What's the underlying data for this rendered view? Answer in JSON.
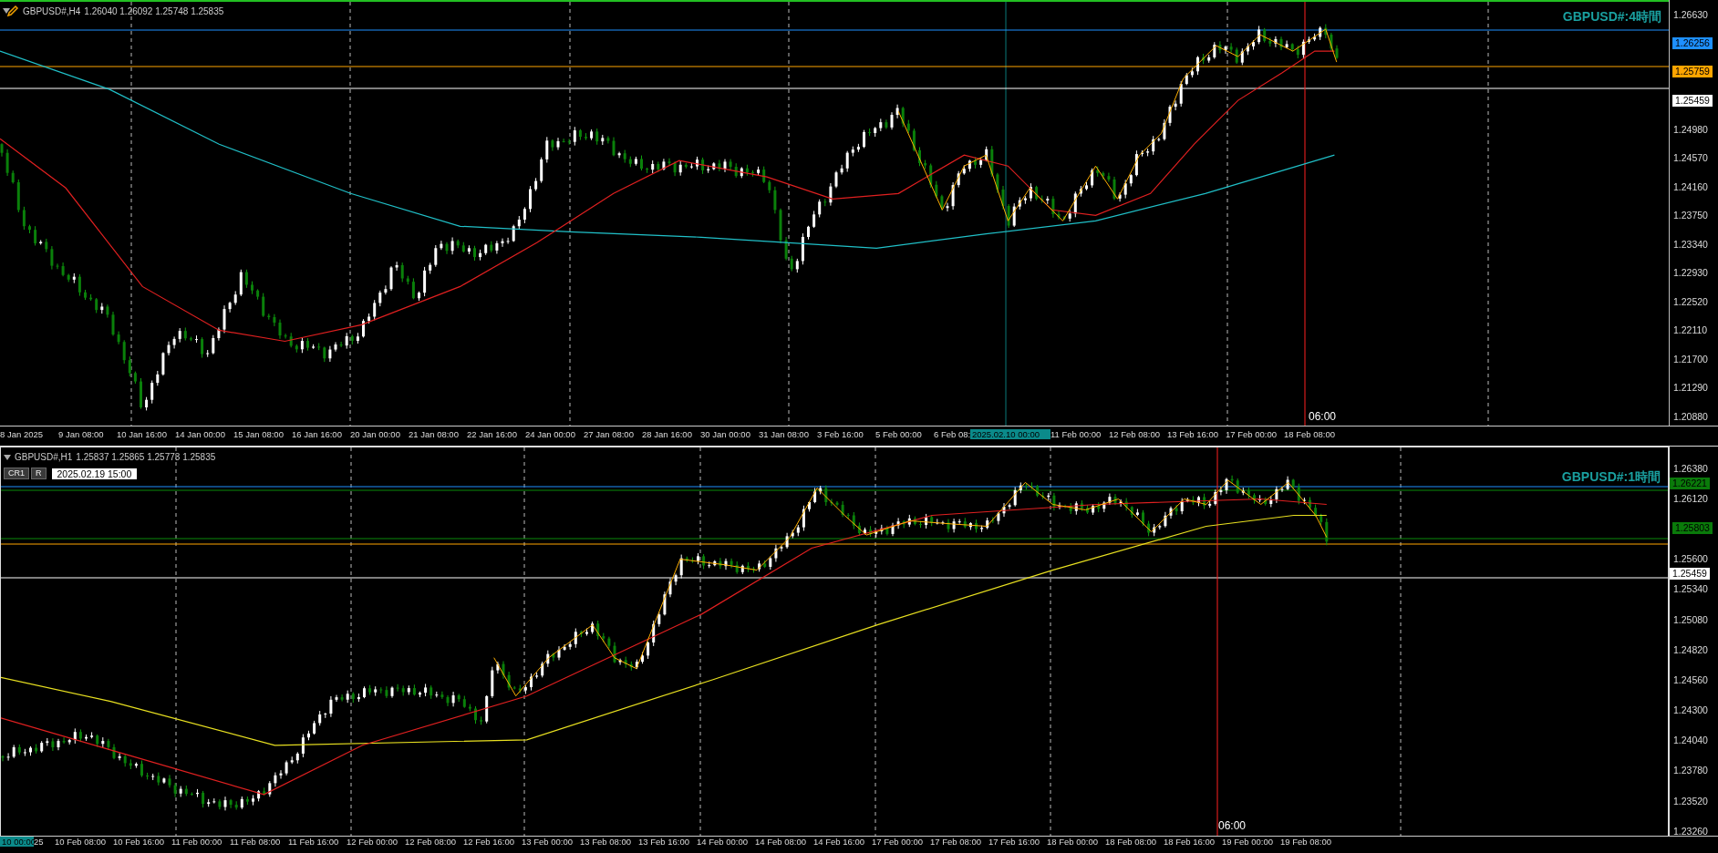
{
  "upper_chart": {
    "symbol": "GBPUSD#,H4",
    "quotes": "1.26040 1.26092 1.25748 1.25835",
    "title": "GBPUSD#:4時間",
    "time_marker": "06:00",
    "price_axis": [
      {
        "kind": "tick",
        "label": "1.26630"
      },
      {
        "kind": "tag",
        "label": "1.26256",
        "color": "#1e90ff"
      },
      {
        "kind": "tag",
        "label": "1.25759",
        "color": "#ffa500"
      },
      {
        "kind": "tag",
        "label": "1.25459",
        "color": "#ffffff"
      },
      {
        "kind": "tick",
        "label": "1.24980"
      },
      {
        "kind": "tick",
        "label": "1.24570"
      },
      {
        "kind": "tick",
        "label": "1.24160"
      },
      {
        "kind": "tick",
        "label": "1.23750"
      },
      {
        "kind": "tick",
        "label": "1.23340"
      },
      {
        "kind": "tick",
        "label": "1.22930"
      },
      {
        "kind": "tick",
        "label": "1.22520"
      },
      {
        "kind": "tick",
        "label": "1.22110"
      },
      {
        "kind": "tick",
        "label": "1.21700"
      },
      {
        "kind": "tick",
        "label": "1.21290"
      },
      {
        "kind": "tick",
        "label": "1.20880"
      }
    ],
    "time_axis": [
      {
        "kind": "tick",
        "label": "8 Jan 2025"
      },
      {
        "kind": "tick",
        "label": "9 Jan 08:00"
      },
      {
        "kind": "tick",
        "label": "10 Jan 16:00"
      },
      {
        "kind": "tick",
        "label": "14 Jan 00:00"
      },
      {
        "kind": "tick",
        "label": "15 Jan 08:00"
      },
      {
        "kind": "tick",
        "label": "16 Jan 16:00"
      },
      {
        "kind": "tick",
        "label": "20 Jan 00:00"
      },
      {
        "kind": "tick",
        "label": "21 Jan 08:00"
      },
      {
        "kind": "tick",
        "label": "22 Jan 16:00"
      },
      {
        "kind": "tick",
        "label": "24 Jan 00:00"
      },
      {
        "kind": "tick",
        "label": "27 Jan 08:00"
      },
      {
        "kind": "tick",
        "label": "28 Jan 16:00"
      },
      {
        "kind": "tick",
        "label": "30 Jan 00:00"
      },
      {
        "kind": "tick",
        "label": "31 Jan 08:00"
      },
      {
        "kind": "tick",
        "label": "3 Feb 16:00"
      },
      {
        "kind": "tick",
        "label": "5 Feb 00:00"
      },
      {
        "kind": "cut",
        "label": "6 Feb 08:"
      },
      {
        "kind": "cursor",
        "label": "2025.02.10 00:00"
      },
      {
        "kind": "tick",
        "label": "11 Feb 00:00"
      },
      {
        "kind": "tick",
        "label": "12 Feb 08:00"
      },
      {
        "kind": "tick",
        "label": "13 Feb 16:00"
      },
      {
        "kind": "tick",
        "label": "17 Feb 00:00"
      },
      {
        "kind": "tick",
        "label": "18 Feb 08:00"
      }
    ]
  },
  "lower_chart": {
    "symbol": "GBPUSD#,H1",
    "quotes": "1.25837 1.25865 1.25773 1.25835",
    "buttons": [
      {
        "label": "CR1"
      },
      {
        "label": "R"
      }
    ],
    "datetime_field": "2025.02.19 15:00",
    "title": "GBPUSD#:1時間",
    "time_marker": "06:00",
    "price_axis": [
      {
        "kind": "tick",
        "label": "1.26380"
      },
      {
        "kind": "between",
        "label": "1.26221",
        "color": "#0a7a0a"
      },
      {
        "kind": "tick",
        "label": "1.26120"
      },
      {
        "kind": "tag",
        "label": "1.25803",
        "color": "#0a7a0a"
      },
      {
        "kind": "tick",
        "label": "1.25600"
      },
      {
        "kind": "between",
        "label": "1.25459",
        "color": "#ffffff"
      },
      {
        "kind": "tick",
        "label": "1.25340"
      },
      {
        "kind": "tick",
        "label": "1.25080"
      },
      {
        "kind": "tick",
        "label": "1.24820"
      },
      {
        "kind": "tick",
        "label": "1.24560"
      },
      {
        "kind": "tick",
        "label": "1.24300"
      },
      {
        "kind": "tick",
        "label": "1.24040"
      },
      {
        "kind": "tick",
        "label": "1.23780"
      },
      {
        "kind": "tick",
        "label": "1.23520"
      },
      {
        "kind": "tick",
        "label": "1.23260"
      }
    ],
    "time_axis": [
      {
        "kind": "cursor",
        "label": "10 00:00"
      },
      {
        "kind": "cut",
        "label": "25"
      },
      {
        "kind": "tick",
        "label": "10 Feb 08:00"
      },
      {
        "kind": "tick",
        "label": "10 Feb 16:00"
      },
      {
        "kind": "tick",
        "label": "11 Feb 00:00"
      },
      {
        "kind": "tick",
        "label": "11 Feb 08:00"
      },
      {
        "kind": "tick",
        "label": "11 Feb 16:00"
      },
      {
        "kind": "tick",
        "label": "12 Feb 00:00"
      },
      {
        "kind": "tick",
        "label": "12 Feb 08:00"
      },
      {
        "kind": "tick",
        "label": "12 Feb 16:00"
      },
      {
        "kind": "tick",
        "label": "13 Feb 00:00"
      },
      {
        "kind": "tick",
        "label": "13 Feb 08:00"
      },
      {
        "kind": "tick",
        "label": "13 Feb 16:00"
      },
      {
        "kind": "tick",
        "label": "14 Feb 00:00"
      },
      {
        "kind": "tick",
        "label": "14 Feb 08:00"
      },
      {
        "kind": "tick",
        "label": "14 Feb 16:00"
      },
      {
        "kind": "tick",
        "label": "17 Feb 00:00"
      },
      {
        "kind": "tick",
        "label": "17 Feb 08:00"
      },
      {
        "kind": "tick",
        "label": "17 Feb 16:00"
      },
      {
        "kind": "tick",
        "label": "18 Feb 00:00"
      },
      {
        "kind": "tick",
        "label": "18 Feb 08:00"
      },
      {
        "kind": "tick",
        "label": "18 Feb 16:00"
      },
      {
        "kind": "tick",
        "label": "19 Feb 00:00"
      },
      {
        "kind": "tick",
        "label": "19 Feb 08:00"
      }
    ]
  }
}
